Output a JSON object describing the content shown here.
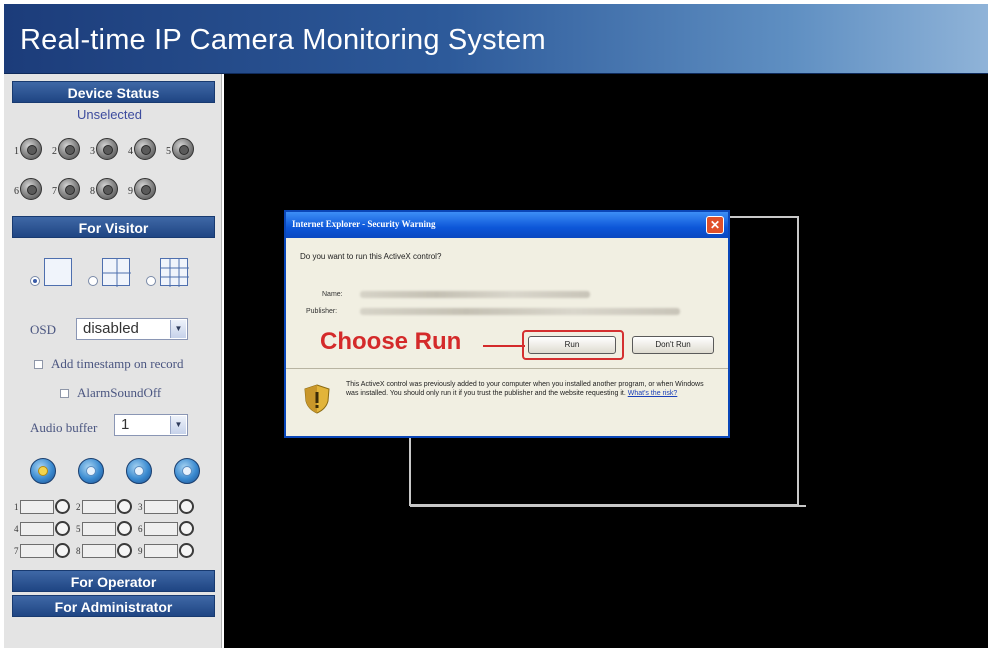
{
  "header": {
    "title": "Real-time IP Camera Monitoring System"
  },
  "sidebar": {
    "device_status": {
      "heading": "Device Status",
      "state": "Unselected",
      "devices": [
        "1",
        "2",
        "3",
        "4",
        "5",
        "6",
        "7",
        "8",
        "9"
      ]
    },
    "visitor": {
      "heading": "For Visitor",
      "osd_label": "OSD",
      "osd_value": "disabled",
      "timestamp_label": "Add timestamp on record",
      "alarm_label": "AlarmSoundOff",
      "audio_buffer_label": "Audio buffer",
      "audio_buffer_value": "1",
      "recorders": [
        "1",
        "2",
        "3",
        "4",
        "5",
        "6",
        "7",
        "8",
        "9"
      ]
    },
    "operator_heading": "For Operator",
    "administrator_heading": "For Administrator"
  },
  "dialog": {
    "title": "Internet Explorer - Security Warning",
    "question": "Do you want to run this ActiveX control?",
    "name_label": "Name:",
    "publisher_label": "Publisher:",
    "run_label": "Run",
    "dont_run_label": "Don't Run",
    "warning_text": "This ActiveX control was previously added to your computer when you installed another program, or when Windows was installed. You should only run it if you trust the publisher and the website requesting it.",
    "risk_link": "What's the risk?"
  },
  "annotation": {
    "choose_run": "Choose Run",
    "color": "#d42a2a"
  },
  "colors": {
    "header_start": "#1c3c7a",
    "header_end": "#8fb3d8",
    "section_head": "#1f4583",
    "video_bg": "#000000",
    "dialog_title": "#0c56d8"
  },
  "icons": {
    "close": "close-icon",
    "shield": "shield-warning-icon",
    "select_arrow": "chevron-down-icon"
  }
}
